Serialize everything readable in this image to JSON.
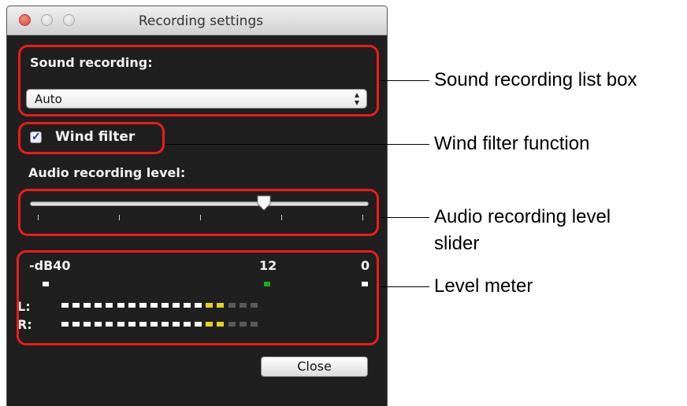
{
  "window": {
    "title": "Recording settings"
  },
  "sound_recording": {
    "label": "Sound recording:",
    "selected": "Auto"
  },
  "wind_filter": {
    "label": "Wind filter",
    "checked": true
  },
  "audio_level": {
    "label": "Audio recording level:",
    "slider_value_fraction": 0.69,
    "tick_count": 5
  },
  "level_meter": {
    "labels": {
      "db40": "-dB40",
      "db12": "12",
      "db0": "0",
      "left": "L:",
      "right": "R:"
    },
    "segments_total": 18,
    "lit_white": 13,
    "lit_yellow": 2,
    "peak_colors": {
      "white": "#ffffff",
      "green": "#22aa22"
    }
  },
  "close_button": {
    "label": "Close"
  },
  "callouts": {
    "sound_recording": "Sound recording list box",
    "wind_filter": "Wind filter function",
    "audio_level_line1": "Audio recording level",
    "audio_level_line2": "slider",
    "level_meter": "Level meter"
  },
  "colors": {
    "highlight": "#ee1b1b",
    "meter_yellow": "#e6d21e",
    "meter_off": "#5a5a5a"
  }
}
